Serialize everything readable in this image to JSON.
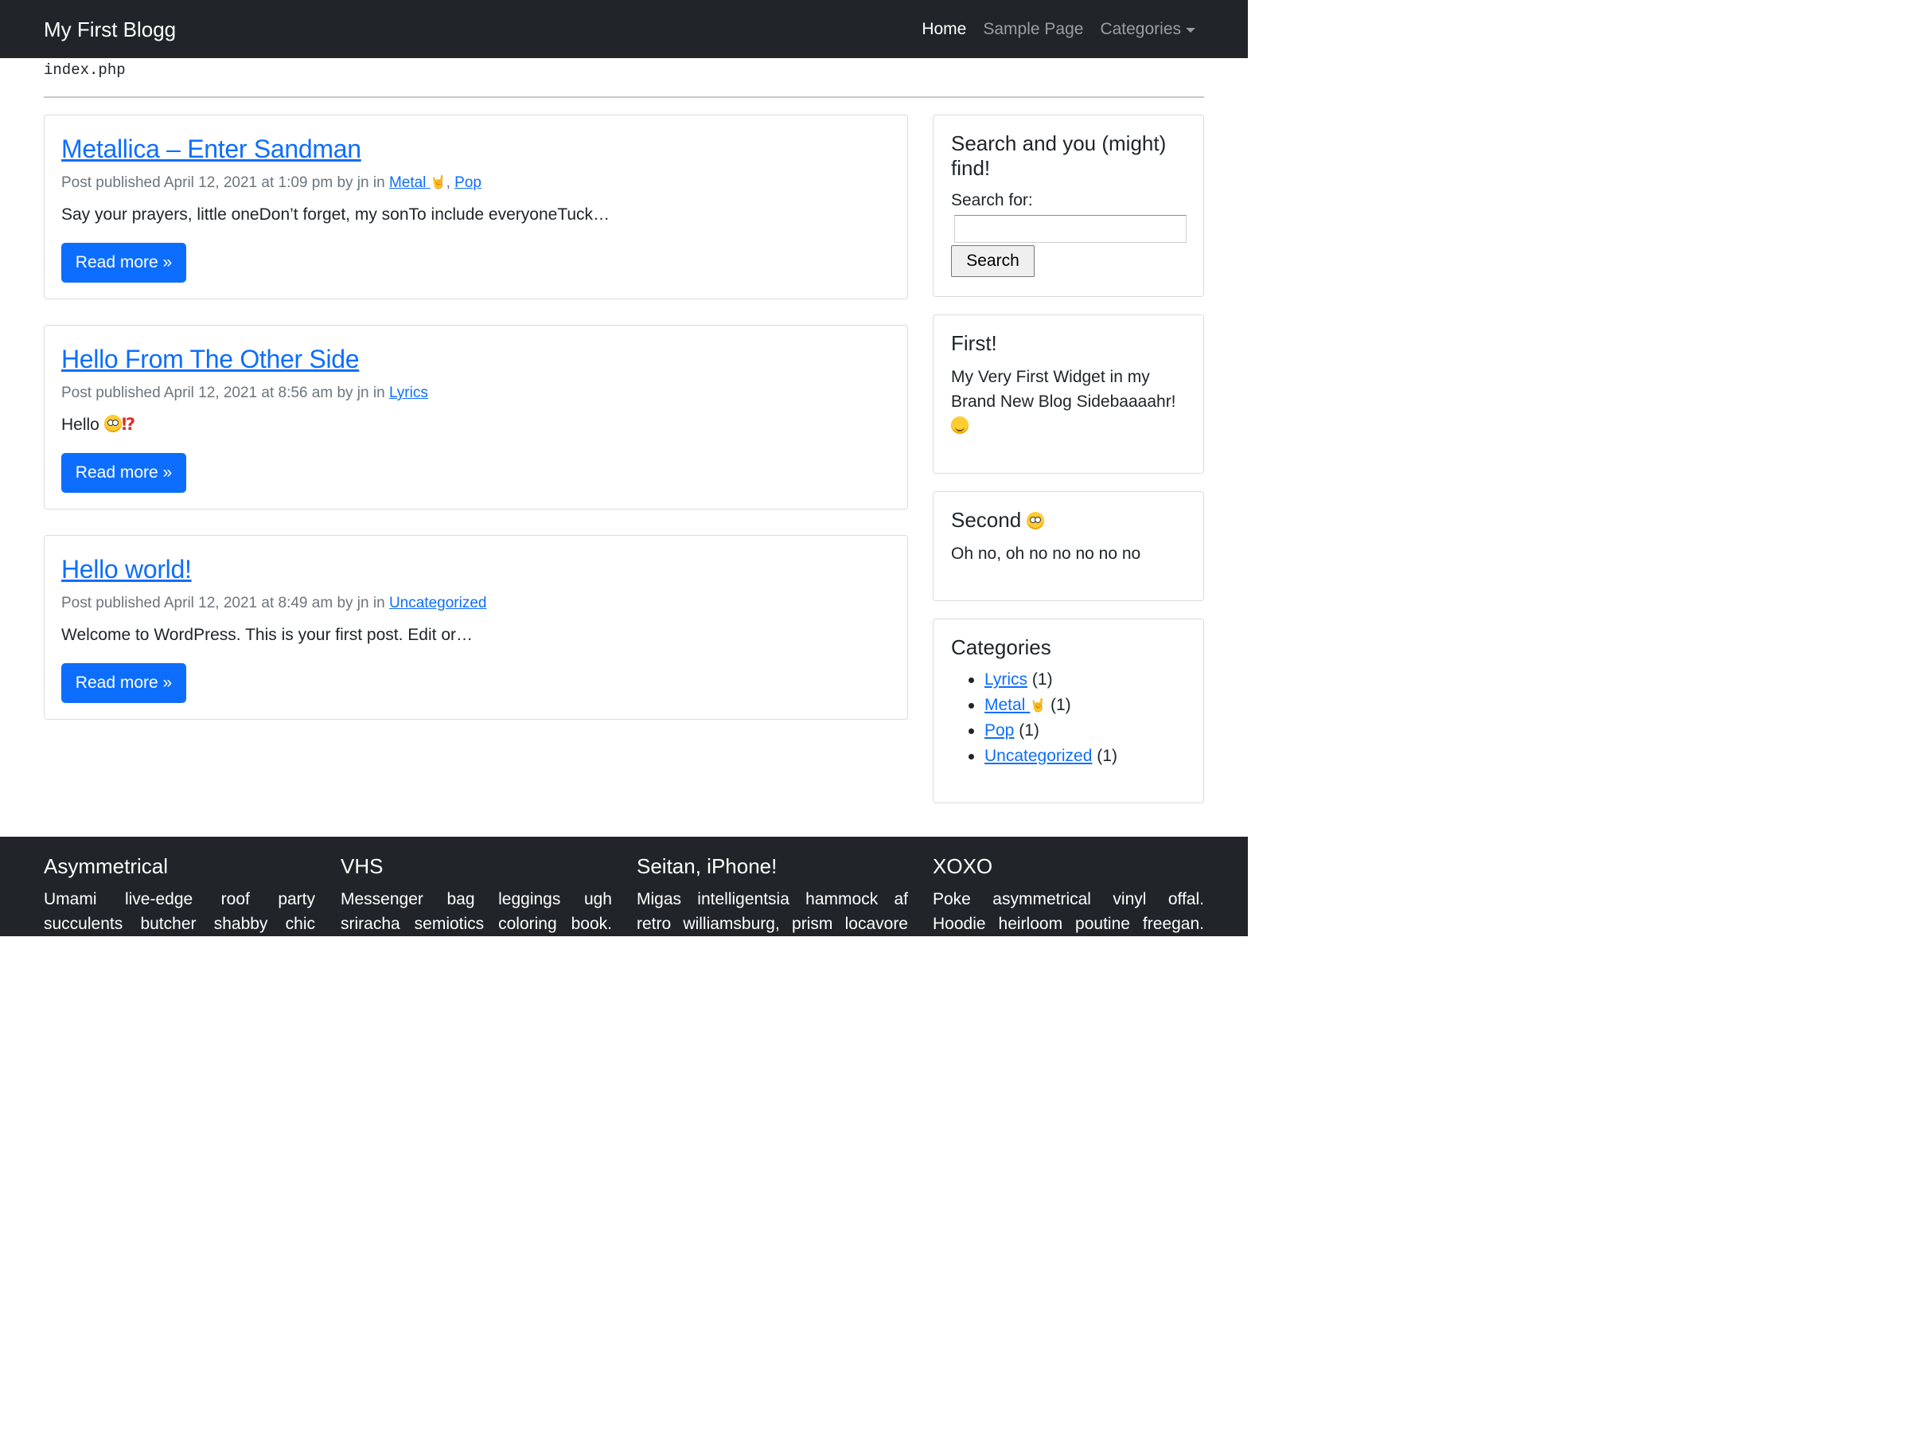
{
  "navbar": {
    "brand": "My First Blogg",
    "links": [
      {
        "label": "Home"
      },
      {
        "label": "Sample Page"
      },
      {
        "label": "Categories"
      }
    ]
  },
  "template_name": "index.php",
  "posts": [
    {
      "title": "Metallica – Enter Sandman",
      "meta_prefix": "Post published April 12, 2021 at 1:09 pm by jn in",
      "categories": [
        "Metal",
        "Pop"
      ],
      "excerpt": "Say your prayers, little oneDon’t forget, my sonTo include everyoneTuck…",
      "read_more": "Read more »"
    },
    {
      "title": "Hello From The Other Side",
      "meta_prefix": "Post published April 12, 2021 at 8:56 am by jn in",
      "categories": [
        "Lyrics"
      ],
      "excerpt": "Hello",
      "read_more": "Read more »"
    },
    {
      "title": "Hello world!",
      "meta_prefix": "Post published April 12, 2021 at 8:49 am by jn in",
      "categories": [
        "Uncategorized"
      ],
      "excerpt": "Welcome to WordPress. This is your first post. Edit or…",
      "read_more": "Read more »"
    }
  ],
  "sidebar": {
    "search": {
      "title": "Search and you (might) find!",
      "label": "Search for:",
      "input_value": "",
      "button": "Search"
    },
    "first": {
      "title": "First!",
      "text": "My Very First Widget in my Brand New Blog Sidebaaaahr!"
    },
    "second": {
      "title": "Second",
      "text": "Oh no, oh no no no no no"
    },
    "categories": {
      "title": "Categories",
      "items": [
        {
          "label": "Lyrics",
          "count": "(1)"
        },
        {
          "label": "Metal",
          "count": "(1)"
        },
        {
          "label": "Pop",
          "count": "(1)"
        },
        {
          "label": "Uncategorized",
          "count": "(1)"
        }
      ]
    }
  },
  "footer": {
    "columns": [
      {
        "title": "Asymmetrical",
        "text": "Umami live-edge roof party succulents butcher shabby chic"
      },
      {
        "title": "VHS",
        "text": "Messenger bag leggings ugh sriracha semiotics coloring book."
      },
      {
        "title": "Seitan, iPhone!",
        "text": "Migas intelligentsia hammock af retro williamsburg, prism locavore"
      },
      {
        "title": "XOXO",
        "text": "Poke asymmetrical vinyl offal. Hoodie heirloom poutine freegan."
      }
    ]
  },
  "colors": {
    "navbar_bg": "#212529",
    "link": "#0d6efd",
    "button_bg": "#0d6efd",
    "meta_text": "#6c757d",
    "footer_bg": "#212529"
  },
  "icons": {
    "metal_emoji": "rock-hand-icon",
    "flushed_emoji": "flushed-face-icon",
    "hug_emoji": "hugging-face-icon",
    "exclamation_emoji": "exclamation-question-icon",
    "dropdown": "caret-down-icon"
  }
}
